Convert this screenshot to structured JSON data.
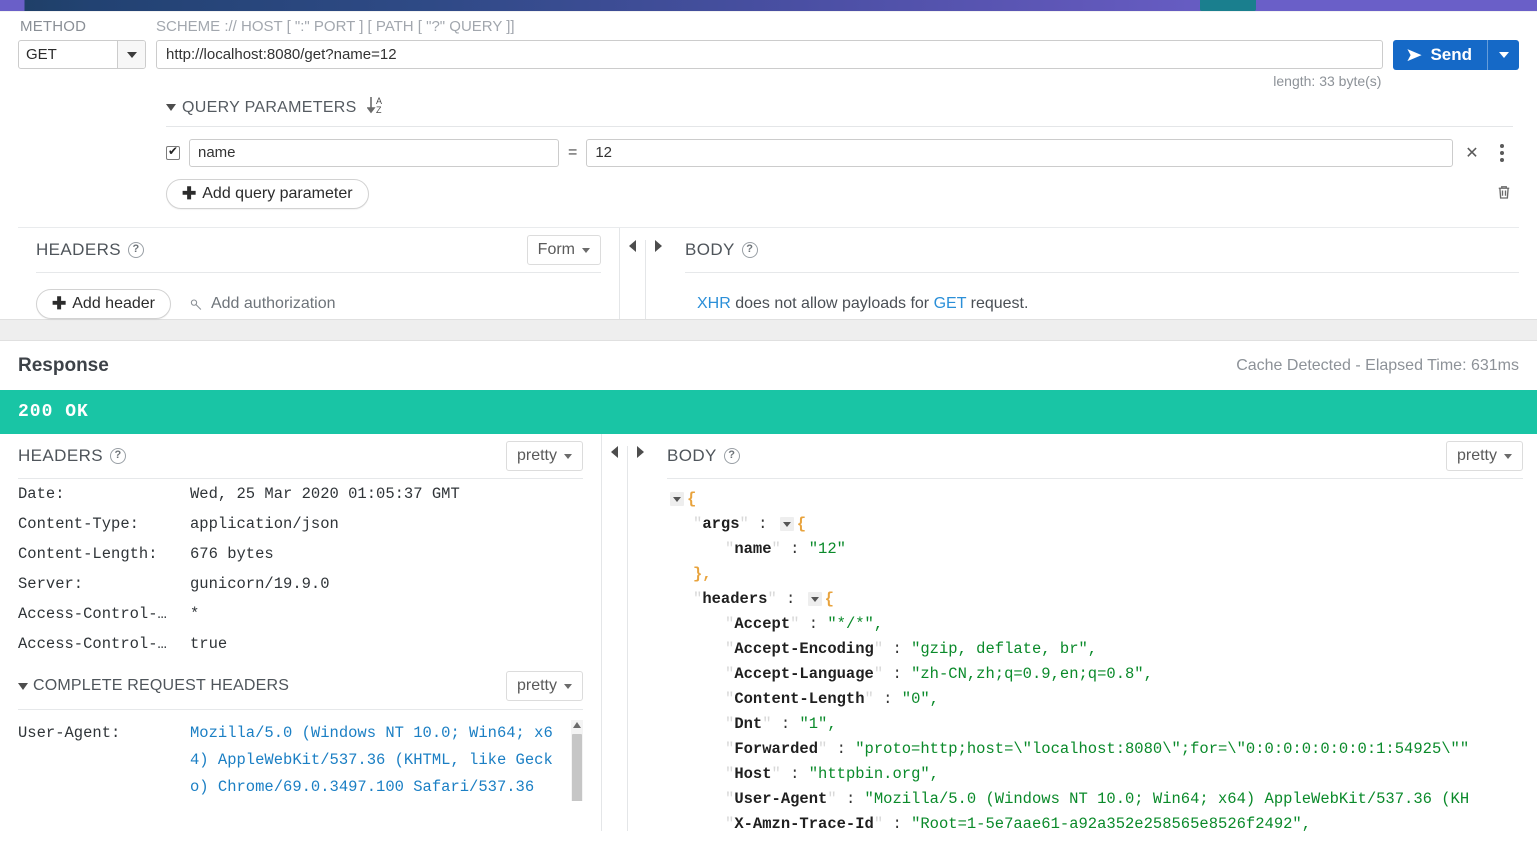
{
  "request": {
    "method_label": "METHOD",
    "method_value": "GET",
    "url_label": "SCHEME :// HOST [ \":\" PORT ] [ PATH [ \"?\" QUERY ]]",
    "url_value": "http://localhost:8080/get?name=12",
    "length_note": "length: 33 byte(s)",
    "send_label": "Send",
    "query_params": {
      "title": "QUERY PARAMETERS",
      "sort_icon": "sort-alpha-down-icon",
      "rows": [
        {
          "enabled": true,
          "key": "name",
          "eq": "=",
          "value": "12"
        }
      ],
      "add_label": "Add query parameter",
      "delete_icon": "trash-icon"
    },
    "headers_panel": {
      "title": "HEADERS",
      "help_icon": "question-circle-icon",
      "mode": "Form",
      "add_header_label": "Add header",
      "add_auth_label": "Add authorization",
      "auth_icon": "key-icon"
    },
    "body_panel": {
      "title": "BODY",
      "help_icon": "question-circle-icon",
      "msg_pre": "XHR",
      "msg_mid": " does not allow payloads for ",
      "msg_method": "GET",
      "msg_post": " request."
    }
  },
  "response": {
    "title": "Response",
    "meta": "Cache Detected - Elapsed Time: 631ms",
    "status_text": "200 OK",
    "status_color": "#19c5a5",
    "headers_panel": {
      "title": "HEADERS",
      "mode": "pretty",
      "rows": [
        {
          "key": "Date:",
          "value": "Wed, 25 Mar 2020 01:05:37 GMT"
        },
        {
          "key": "Content-Type:",
          "value": "application/json"
        },
        {
          "key": "Content-Length:",
          "value": "676 bytes"
        },
        {
          "key": "Server:",
          "value": "gunicorn/19.9.0"
        },
        {
          "key": "Access-Control-…",
          "value": "*"
        },
        {
          "key": "Access-Control-…",
          "value": "true"
        }
      ]
    },
    "complete_request_headers": {
      "title": "COMPLETE REQUEST HEADERS",
      "mode": "pretty",
      "rows": [
        {
          "key": "User-Agent:",
          "value": "Mozilla/5.0 (Windows NT 10.0; Win64; x64) AppleWebKit/537.36 (KHTML, like Gecko) Chrome/69.0.3497.100 Safari/537.36"
        }
      ]
    },
    "body_panel": {
      "title": "BODY",
      "mode": "pretty",
      "json_lines": [
        {
          "indent": 0,
          "twist": true,
          "text": "{",
          "type": "brace"
        },
        {
          "indent": 1,
          "key": "args",
          "twist": true,
          "text": "{",
          "type": "open"
        },
        {
          "indent": 2,
          "key": "name",
          "value": "\"12\"",
          "type": "pair"
        },
        {
          "indent": 1,
          "text": "},",
          "type": "brace"
        },
        {
          "indent": 1,
          "key": "headers",
          "twist": true,
          "text": "{",
          "type": "open"
        },
        {
          "indent": 2,
          "key": "Accept",
          "value": "\"*/*\",",
          "type": "pair"
        },
        {
          "indent": 2,
          "key": "Accept-Encoding",
          "value": "\"gzip, deflate, br\",",
          "type": "pair"
        },
        {
          "indent": 2,
          "key": "Accept-Language",
          "value": "\"zh-CN,zh;q=0.9,en;q=0.8\",",
          "type": "pair"
        },
        {
          "indent": 2,
          "key": "Content-Length",
          "value": "\"0\",",
          "type": "pair"
        },
        {
          "indent": 2,
          "key": "Dnt",
          "value": "\"1\",",
          "type": "pair"
        },
        {
          "indent": 2,
          "key": "Forwarded",
          "value": "\"proto=http;host=\\\"localhost:8080\\\";for=\\\"0:0:0:0:0:0:0:1:54925\\\"\"",
          "type": "pair"
        },
        {
          "indent": 2,
          "key": "Host",
          "value": "\"httpbin.org\",",
          "type": "pair"
        },
        {
          "indent": 2,
          "key": "User-Agent",
          "value": "\"Mozilla/5.0 (Windows NT 10.0; Win64; x64) AppleWebKit/537.36 (KH",
          "type": "pair"
        },
        {
          "indent": 2,
          "key": "X-Amzn-Trace-Id",
          "value": "\"Root=1-5e7aae61-a92a352e258565e8526f2492\",",
          "type": "pair"
        }
      ]
    }
  }
}
